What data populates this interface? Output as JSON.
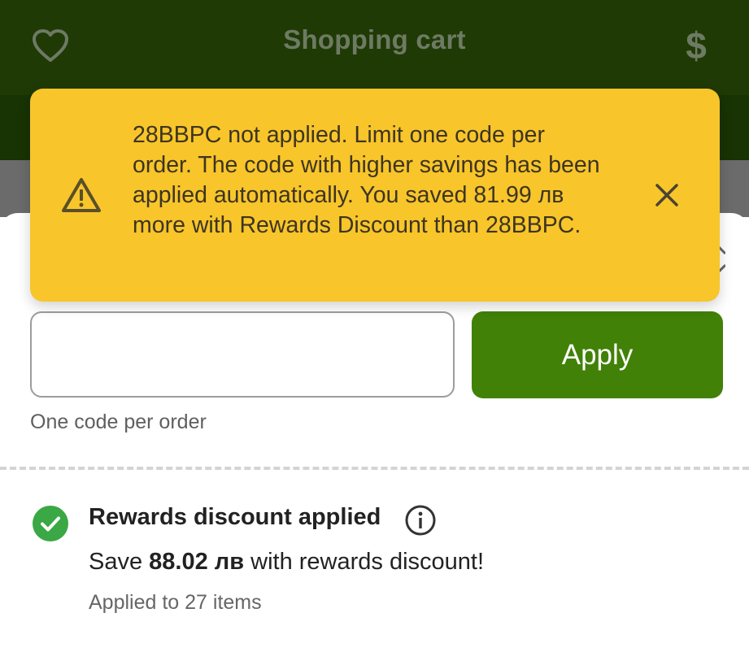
{
  "header": {
    "title": "Shopping cart",
    "left_icon": "heart-icon",
    "right_icon": "dollar-icon"
  },
  "toast": {
    "icon": "warning-icon",
    "message": "28BBPC not applied. Limit one code per order. The code with higher savings has been applied automatically. You saved 81.99 лв more with Rewards Discount than 28BBPC.",
    "close_icon": "close-icon",
    "color": "#f8c52b"
  },
  "promo": {
    "input_value": "",
    "apply_label": "Apply",
    "hint": "One code per order",
    "accent": "#418107"
  },
  "rewards": {
    "icon": "check-circle-icon",
    "title": "Rewards discount applied",
    "info_icon": "info-icon",
    "save_prefix": "Save ",
    "save_amount": "88.02 лв",
    "save_suffix": " with rewards discount!",
    "applied_to": "Applied to 27 items",
    "check_color": "#3aa844"
  }
}
